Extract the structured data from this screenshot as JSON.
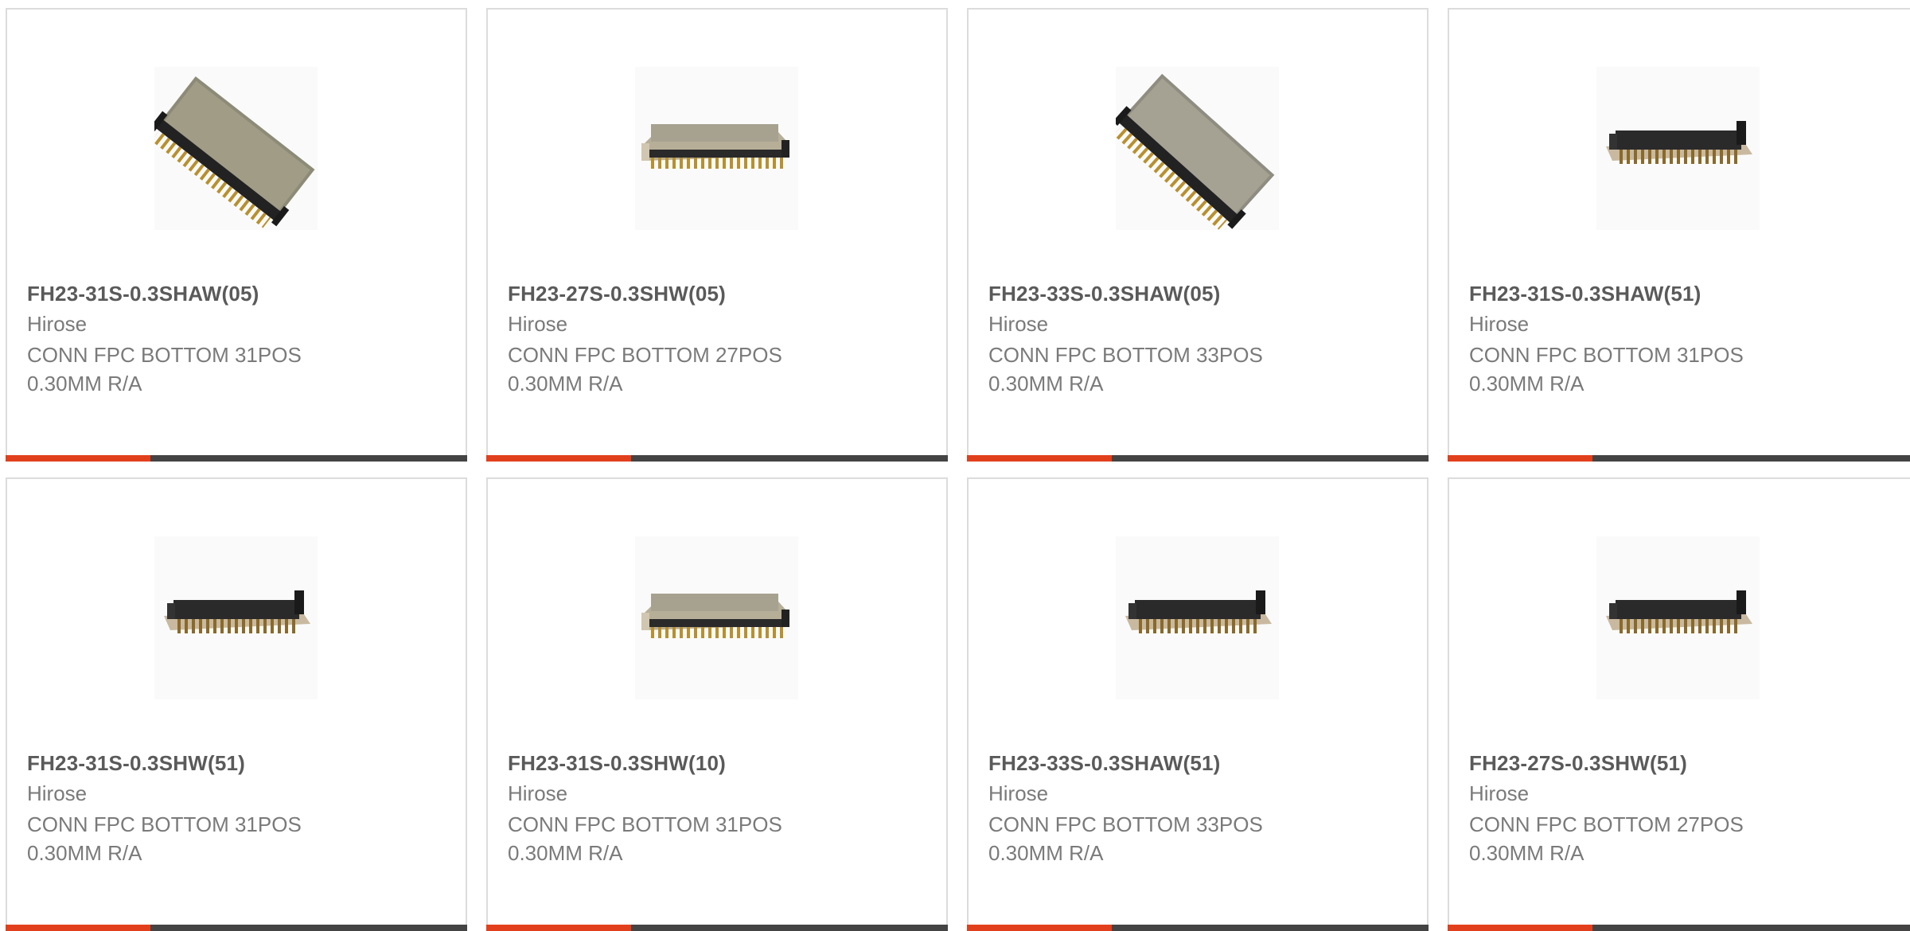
{
  "accent_color": "#e2401c",
  "bar_color": "#444444",
  "products": [
    {
      "part": "FH23-31S-0.3SHAW(05)",
      "manufacturer": "Hirose",
      "description": "CONN FPC BOTTOM 31POS 0.30MM R/A",
      "image": "connector-angled"
    },
    {
      "part": "FH23-27S-0.3SHW(05)",
      "manufacturer": "Hirose",
      "description": "CONN FPC BOTTOM 27POS 0.30MM R/A",
      "image": "connector-flat-light"
    },
    {
      "part": "FH23-33S-0.3SHAW(05)",
      "manufacturer": "Hirose",
      "description": "CONN FPC BOTTOM 33POS 0.30MM R/A",
      "image": "connector-angled"
    },
    {
      "part": "FH23-31S-0.3SHAW(51)",
      "manufacturer": "Hirose",
      "description": "CONN FPC BOTTOM 31POS 0.30MM R/A",
      "image": "connector-flat-dark"
    },
    {
      "part": "FH23-31S-0.3SHW(51)",
      "manufacturer": "Hirose",
      "description": "CONN FPC BOTTOM 31POS 0.30MM R/A",
      "image": "connector-flat-dark"
    },
    {
      "part": "FH23-31S-0.3SHW(10)",
      "manufacturer": "Hirose",
      "description": "CONN FPC BOTTOM 31POS 0.30MM R/A",
      "image": "connector-flat-light"
    },
    {
      "part": "FH23-33S-0.3SHAW(51)",
      "manufacturer": "Hirose",
      "description": "CONN FPC BOTTOM 33POS 0.30MM R/A",
      "image": "connector-flat-dark"
    },
    {
      "part": "FH23-27S-0.3SHW(51)",
      "manufacturer": "Hirose",
      "description": "CONN FPC BOTTOM 27POS 0.30MM R/A",
      "image": "connector-flat-dark"
    }
  ]
}
